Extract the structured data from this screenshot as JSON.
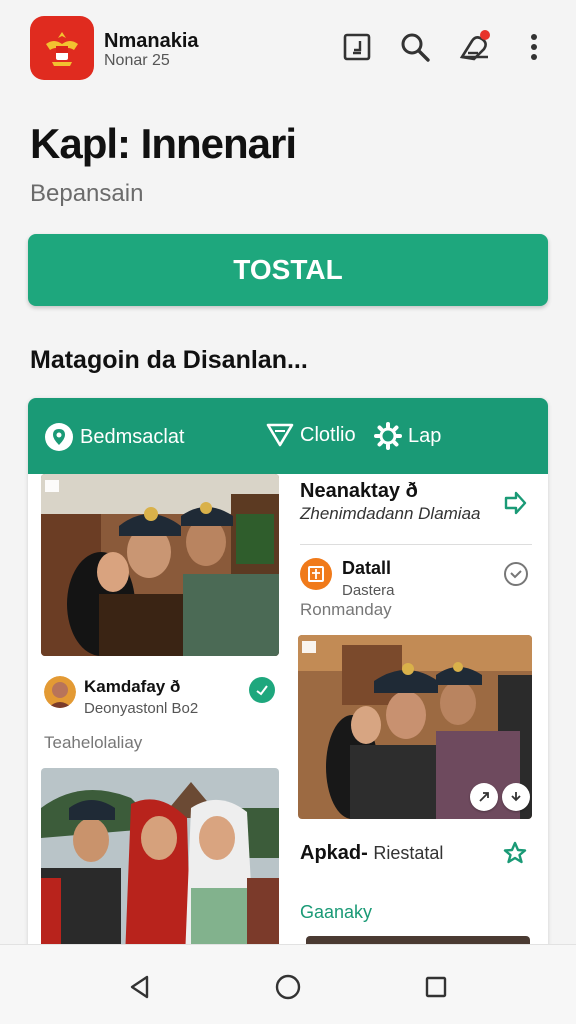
{
  "header": {
    "app_name": "Nmanakia",
    "app_sub": "Nonar 25"
  },
  "page": {
    "title": "Kapl: Innenari",
    "subtitle": "Bepansain",
    "primary_button": "TOSTAL",
    "section_title": "Matagoin da Disanlan..."
  },
  "card": {
    "tabs": [
      {
        "label": "Bedmsaclat",
        "icon": "location-pin-icon"
      },
      {
        "label": "Clotlio",
        "icon": "filter-icon"
      },
      {
        "label": "Lap",
        "icon": "gear-icon"
      }
    ],
    "left": {
      "author_name": "Kamdafay ð",
      "author_sub": "Deonyastonl Bo2",
      "caption": "Teahelolaliay"
    },
    "right": {
      "title": "Neanaktay ð",
      "subtitle": "Zhenimdadann Dlamiaa",
      "item_name": "Datall",
      "item_sub": "Dastera",
      "item_caption": "Ronmanday",
      "post_title": "Apkad-",
      "post_title_rest": "Riestatal",
      "post_caption": "Gaanaky"
    }
  },
  "colors": {
    "accent": "#1ea77d",
    "header_green": "#1a9a76",
    "logo_red": "#e02b1f",
    "notification": "#e8322b"
  }
}
